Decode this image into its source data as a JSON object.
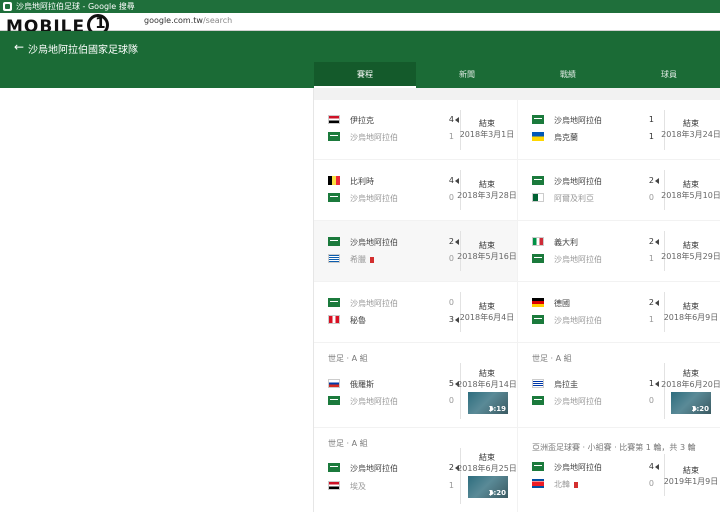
{
  "window": {
    "title": "沙烏地阿拉伯足球 - Google 搜尋"
  },
  "address_bar": {
    "logo": "MOBILE",
    "logo_mark": "01",
    "url_host": "google.com.tw",
    "url_path": "/search"
  },
  "header": {
    "title": "沙烏地阿拉伯國家足球隊"
  },
  "tabs": [
    {
      "label": "賽程",
      "active": true
    },
    {
      "label": "新聞",
      "active": false
    },
    {
      "label": "戰績",
      "active": false
    },
    {
      "label": "球員",
      "active": false
    }
  ],
  "matches": [
    {
      "home": {
        "name": "伊拉克",
        "flag": "eg",
        "score": "4"
      },
      "away": {
        "name": "沙烏地阿拉伯",
        "flag": "sa",
        "score": "1"
      },
      "status": "結束",
      "date": "2018年3月1日"
    },
    {
      "home": {
        "name": "沙烏地阿拉伯",
        "flag": "sa",
        "score": "1"
      },
      "away": {
        "name": "烏克蘭",
        "flag": "ua",
        "score": "1"
      },
      "status": "結束",
      "date": "2018年3月24日"
    },
    {
      "home": {
        "name": "比利時",
        "flag": "be",
        "score": "4"
      },
      "away": {
        "name": "沙烏地阿拉伯",
        "flag": "sa",
        "score": "0"
      },
      "status": "結束",
      "date": "2018年3月28日"
    },
    {
      "home": {
        "name": "沙烏地阿拉伯",
        "flag": "sa",
        "score": "2"
      },
      "away": {
        "name": "阿爾及利亞",
        "flag": "dz",
        "score": "0"
      },
      "status": "結束",
      "date": "2018年5月10日"
    },
    {
      "home": {
        "name": "沙烏地阿拉伯",
        "flag": "sa",
        "score": "2"
      },
      "away": {
        "name": "希臘",
        "flag": "gr",
        "score": "0"
      },
      "status": "結束",
      "date": "2018年5月16日"
    },
    {
      "home": {
        "name": "義大利",
        "flag": "it",
        "score": "2"
      },
      "away": {
        "name": "沙烏地阿拉伯",
        "flag": "sa",
        "score": "1"
      },
      "status": "結束",
      "date": "2018年5月29日"
    },
    {
      "home": {
        "name": "沙烏地阿拉伯",
        "flag": "sa",
        "score": "0"
      },
      "away": {
        "name": "秘魯",
        "flag": "pe",
        "score": "3"
      },
      "status": "結束",
      "date": "2018年6月4日"
    },
    {
      "home": {
        "name": "德國",
        "flag": "de",
        "score": "2"
      },
      "away": {
        "name": "沙烏地阿拉伯",
        "flag": "sa",
        "score": "1"
      },
      "status": "結束",
      "date": "2018年6月9日"
    },
    {
      "group": "世足 · A 組",
      "home": {
        "name": "俄羅斯",
        "flag": "ru",
        "score": "5"
      },
      "away": {
        "name": "沙烏地阿拉伯",
        "flag": "sa",
        "score": "0"
      },
      "status": "結束",
      "date": "2018年6月14日",
      "video": "3:19"
    },
    {
      "group": "世足 · A 組",
      "home": {
        "name": "烏拉圭",
        "flag": "uy",
        "score": "1"
      },
      "away": {
        "name": "沙烏地阿拉伯",
        "flag": "sa",
        "score": "0"
      },
      "status": "結束",
      "date": "2018年6月20日",
      "video": "3:20"
    },
    {
      "group": "世足 · A 組",
      "home": {
        "name": "沙烏地阿拉伯",
        "flag": "sa",
        "score": "2"
      },
      "away": {
        "name": "埃及",
        "flag": "eg",
        "score": "1"
      },
      "status": "結束",
      "date": "2018年6月25日",
      "video": "3:20"
    },
    {
      "group": "亞洲盃足球賽 · 小組賽 · 比賽第 1 輪，共 3 輪",
      "home": {
        "name": "沙烏地阿拉伯",
        "flag": "sa",
        "score": "4"
      },
      "away": {
        "name": "北韓",
        "flag": "kp",
        "score": "0"
      },
      "status": "結束",
      "date": "2019年1月9日"
    }
  ]
}
